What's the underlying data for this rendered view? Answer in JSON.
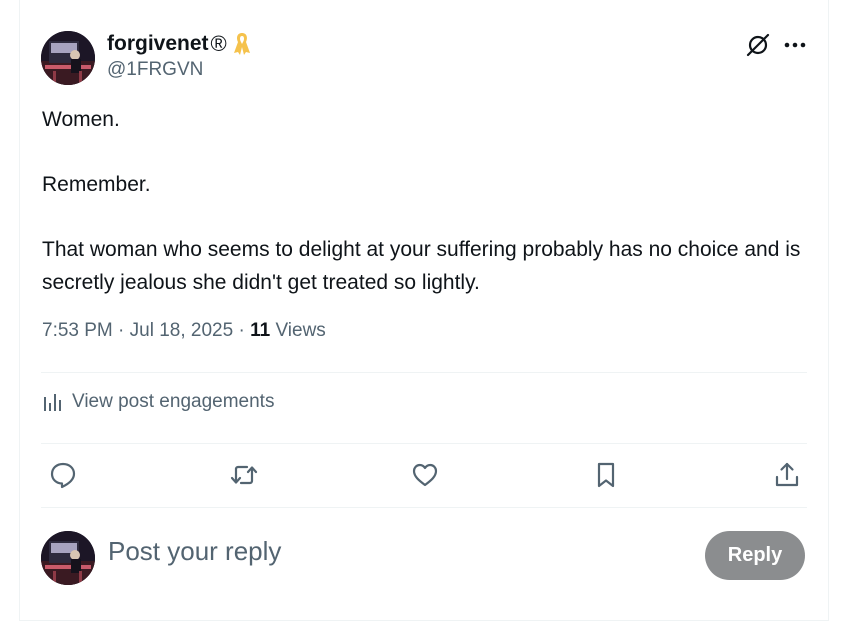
{
  "author": {
    "display_name": "forgivenet",
    "registered_mark": "®",
    "handle": "@1FRGVN"
  },
  "tweet": {
    "paragraphs": [
      "Women.",
      "Remember.",
      "That woman who seems to delight at your suffering probably has no choice and is secretly jealous she didn't get treated so lightly."
    ],
    "time": "7:53 PM",
    "date": "Jul 18, 2025",
    "separator": " · ",
    "views_count": "11",
    "views_label": "Views"
  },
  "engagements_link": "View post engagements",
  "icons": {
    "grok": "grok-icon",
    "more": "more-icon",
    "reply": "reply-icon",
    "retweet": "retweet-icon",
    "like": "heart-icon",
    "bookmark": "bookmark-icon",
    "share": "share-icon",
    "engagements": "bar-chart-icon",
    "badge": "awareness-ribbon-icon"
  },
  "reply_box": {
    "placeholder": "Post your reply",
    "button_label": "Reply"
  },
  "colors": {
    "text": "#0f1419",
    "secondary": "#536471",
    "divider": "#eff3f4",
    "reply_button": "#8b8d8f",
    "ribbon": "#f5c24c"
  }
}
